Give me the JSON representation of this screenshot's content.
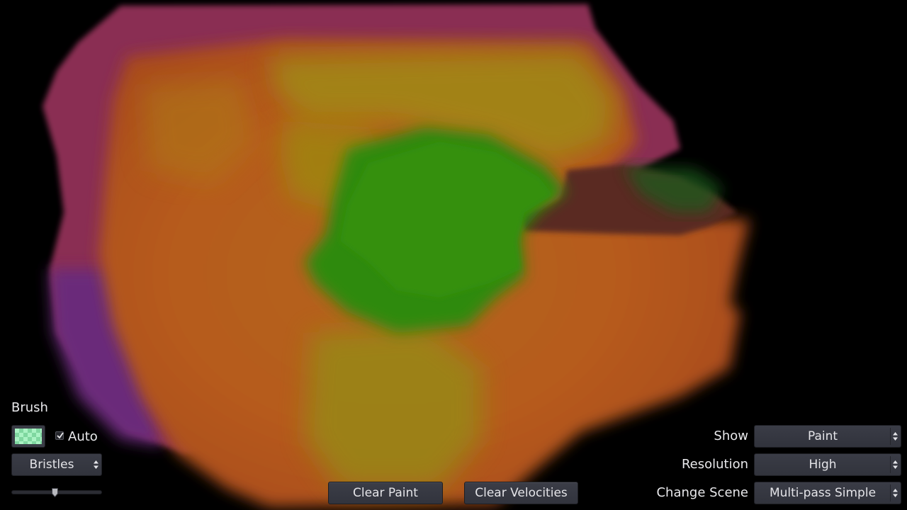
{
  "brush": {
    "section_label": "Brush",
    "auto_label": "Auto",
    "auto_checked": true,
    "swatch_color": "#a9f2c3",
    "brush_type": "Bristles",
    "size_fraction": 0.48
  },
  "actions": {
    "clear_paint": "Clear Paint",
    "clear_velocities": "Clear Velocities"
  },
  "settings": {
    "show_label": "Show",
    "show_value": "Paint",
    "resolution_label": "Resolution",
    "resolution_value": "High",
    "scene_label": "Change Scene",
    "scene_value": "Multi-pass Simple"
  },
  "icons": {
    "check": "check-icon",
    "dropdown": "updown-arrows-icon"
  }
}
